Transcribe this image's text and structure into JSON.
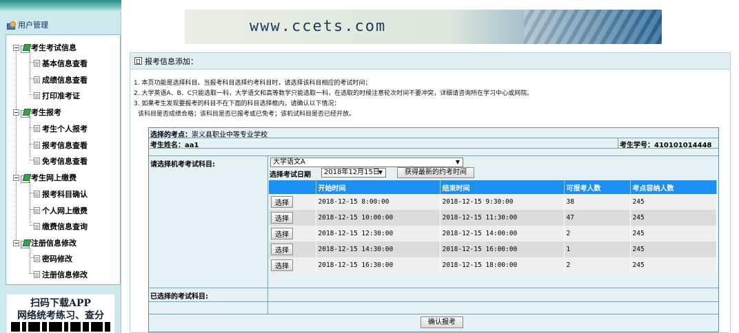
{
  "sidebar": {
    "user_mgmt": "用户管理",
    "groups": [
      {
        "label": "考生考试信息",
        "items": [
          "基本信息查看",
          "成绩信息查看",
          "打印准考证"
        ]
      },
      {
        "label": "考生报考",
        "items": [
          "考生个人报考",
          "报考信息查看",
          "免考信息查看"
        ]
      },
      {
        "label": "考生网上缴费",
        "items": [
          "报考科目确认",
          "个人网上缴费",
          "缴费信息查询"
        ]
      },
      {
        "label": "注册信息修改",
        "items": [
          "密码修改",
          "注册信息修改"
        ]
      }
    ],
    "app_promo": {
      "line1": "扫码下载APP",
      "line2": "网络统考练习、查分"
    }
  },
  "banner": {
    "text": "www.ccets.com"
  },
  "main": {
    "title": "报考信息添加：",
    "notes": [
      "1. 本页功能是选择科目。当报考科目选择约考科目时，请选择该科目相应的考试时间；",
      "2. 大学英语A、B、C只能选取一科，大学语文和高等数学只能选取一科，在选取的时候注意轮次时间不要冲突，详细请咨询所在学习中心或网院。",
      "3. 如果考生发现要报考的科目不在下面的科目选择框内，请确认以下情况：",
      "该科目是否成绩合格；该科目是否已报考或已免考；该机试科目是否已经开放。"
    ],
    "form": {
      "site_label": "选择的考点：",
      "site_value": "崇义县职业中等专业学校",
      "name_label": "考生姓名：",
      "name_value": "aa1",
      "id_label": "考生学号：",
      "id_value": "410101014448",
      "subject_label": "请选择机考考试科目:",
      "subject_value": "大学语文A",
      "date_label": "选择考试日期",
      "date_value": "2018年12月15日",
      "refresh_label": "获得最新的约考时间",
      "selected_label": "已选择的考试科目:",
      "confirm_label": "确认报考",
      "select_btn_label": "选择"
    },
    "table": {
      "headers": [
        "",
        "开始时间",
        "结束时间",
        "可报考人数",
        "考点容纳人数"
      ],
      "rows": [
        [
          "2018-12-15 8:00:00",
          "2018-12-15 9:30:00",
          "38",
          "245"
        ],
        [
          "2018-12-15 10:00:00",
          "2018-12-15 11:30:00",
          "47",
          "245"
        ],
        [
          "2018-12-15 12:30:00",
          "2018-12-15 14:00:00",
          "2",
          "245"
        ],
        [
          "2018-12-15 14:30:00",
          "2018-12-15 16:00:00",
          "1",
          "245"
        ],
        [
          "2018-12-15 16:30:00",
          "2018-12-15 18:00:00",
          "2",
          "245"
        ]
      ]
    }
  }
}
